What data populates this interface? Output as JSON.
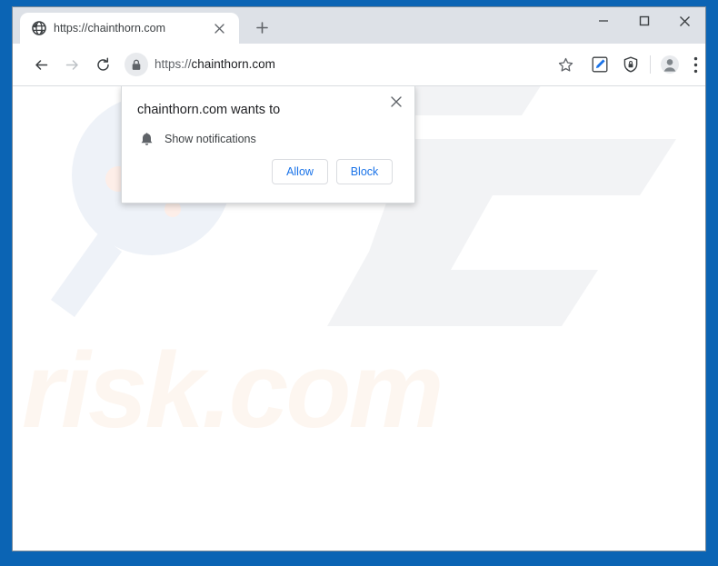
{
  "window": {
    "frame_color": "#0b64b4",
    "titlebar_color": "#dde1e7",
    "controls": {
      "minimize_label": "–",
      "maximize_label": "□",
      "close_label": "✕"
    }
  },
  "tab": {
    "favicon": "globe-icon",
    "title": "https://chainthorn.com",
    "close_label": "✕",
    "new_tab_label": "+"
  },
  "toolbar": {
    "back_icon": "back-arrow-icon",
    "forward_icon": "forward-arrow-icon",
    "reload_icon": "reload-icon",
    "omnibox": {
      "lock_icon": "lock-icon",
      "scheme": "https://",
      "host": "chainthorn.com",
      "full_url": "https://chainthorn.com"
    },
    "actions": [
      {
        "name": "bookmark-star-icon",
        "label": "☆"
      },
      {
        "name": "edit-pencil-icon",
        "label": ""
      },
      {
        "name": "shield-icon",
        "label": ""
      },
      {
        "name": "profile-avatar-icon",
        "label": ""
      },
      {
        "name": "three-dot-menu-icon",
        "label": "⋮"
      }
    ],
    "accent_color": "#1a73e8"
  },
  "permission_dialog": {
    "title": "chainthorn.com wants to",
    "close_label": "✕",
    "option_icon": "bell-icon",
    "option_label": "Show notifications",
    "allow_label": "Allow",
    "block_label": "Block",
    "button_text_color": "#1a73e8"
  },
  "page": {
    "background_color": "#ffffff",
    "watermark": {
      "logo_text": "PC",
      "logo_color": "#f2f3f5",
      "magnifier_color": "#eef2f8",
      "magnifier_dot_color": "#fdeee8",
      "domain_text": "risk.com",
      "domain_color": "#fdf6f0"
    }
  }
}
